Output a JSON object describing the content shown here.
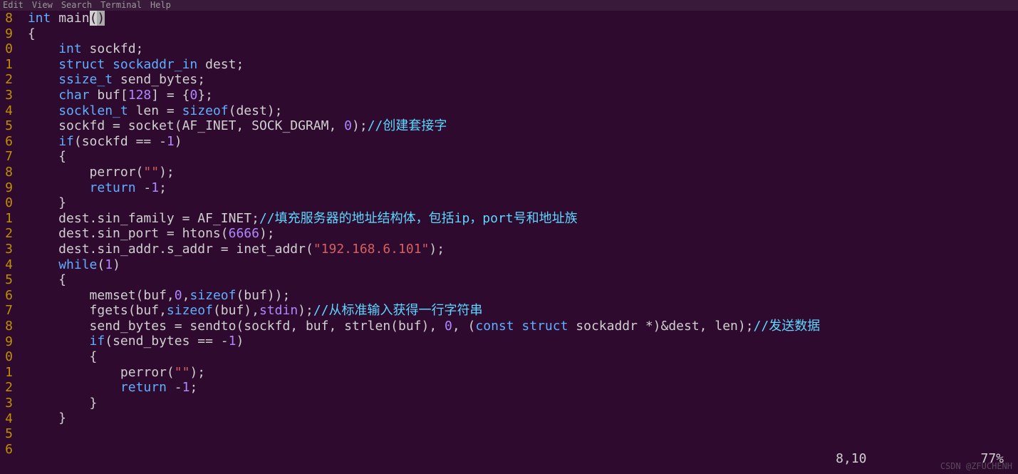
{
  "menubar": [
    "Edit",
    "View",
    "Search",
    "Terminal",
    "Help"
  ],
  "lines": [
    {
      "n": "8",
      "tokens": [
        {
          "t": " ",
          "c": ""
        },
        {
          "t": "int",
          "c": "type"
        },
        {
          "t": " ",
          "c": ""
        },
        {
          "t": "main",
          "c": "id"
        },
        {
          "t": "(",
          "c": "paren-hl"
        },
        {
          "t": ")",
          "c": "cursor"
        }
      ]
    },
    {
      "n": "9",
      "tokens": [
        {
          "t": " {",
          "c": ""
        }
      ]
    },
    {
      "n": "0",
      "tokens": [
        {
          "t": "     ",
          "c": ""
        },
        {
          "t": "int",
          "c": "type"
        },
        {
          "t": " sockfd;",
          "c": ""
        }
      ]
    },
    {
      "n": "1",
      "tokens": [
        {
          "t": "     ",
          "c": ""
        },
        {
          "t": "struct",
          "c": "kw"
        },
        {
          "t": " ",
          "c": ""
        },
        {
          "t": "sockaddr_in",
          "c": "type"
        },
        {
          "t": " dest;",
          "c": ""
        }
      ]
    },
    {
      "n": "2",
      "tokens": [
        {
          "t": "     ",
          "c": ""
        },
        {
          "t": "ssize_t",
          "c": "type"
        },
        {
          "t": " send_bytes;",
          "c": ""
        }
      ]
    },
    {
      "n": "3",
      "tokens": [
        {
          "t": "     ",
          "c": ""
        },
        {
          "t": "char",
          "c": "type"
        },
        {
          "t": " buf[",
          "c": ""
        },
        {
          "t": "128",
          "c": "num"
        },
        {
          "t": "] = {",
          "c": ""
        },
        {
          "t": "0",
          "c": "num"
        },
        {
          "t": "};",
          "c": ""
        }
      ]
    },
    {
      "n": "4",
      "tokens": [
        {
          "t": "     ",
          "c": ""
        },
        {
          "t": "socklen_t",
          "c": "type"
        },
        {
          "t": " len = ",
          "c": ""
        },
        {
          "t": "sizeof",
          "c": "kw"
        },
        {
          "t": "(dest);",
          "c": ""
        }
      ]
    },
    {
      "n": "5",
      "tokens": [
        {
          "t": "     sockfd = socket(AF_INET, SOCK_DGRAM, ",
          "c": ""
        },
        {
          "t": "0",
          "c": "num"
        },
        {
          "t": ");",
          "c": ""
        },
        {
          "t": "//创建套接字",
          "c": "cmt"
        }
      ]
    },
    {
      "n": "6",
      "tokens": [
        {
          "t": "     ",
          "c": ""
        },
        {
          "t": "if",
          "c": "kw"
        },
        {
          "t": "(sockfd == -",
          "c": ""
        },
        {
          "t": "1",
          "c": "num"
        },
        {
          "t": ")",
          "c": ""
        }
      ]
    },
    {
      "n": "7",
      "tokens": [
        {
          "t": "     {",
          "c": ""
        }
      ]
    },
    {
      "n": "8",
      "tokens": [
        {
          "t": "         perror(",
          "c": ""
        },
        {
          "t": "\"\"",
          "c": "str"
        },
        {
          "t": ");",
          "c": ""
        }
      ]
    },
    {
      "n": "9",
      "tokens": [
        {
          "t": "         ",
          "c": ""
        },
        {
          "t": "return",
          "c": "kw"
        },
        {
          "t": " -",
          "c": ""
        },
        {
          "t": "1",
          "c": "num"
        },
        {
          "t": ";",
          "c": ""
        }
      ]
    },
    {
      "n": "0",
      "tokens": [
        {
          "t": "     }",
          "c": ""
        }
      ]
    },
    {
      "n": "1",
      "tokens": [
        {
          "t": "     dest.sin_family = AF_INET;",
          "c": ""
        },
        {
          "t": "//填充服务器的地址结构体，包括ip，port号和地址族",
          "c": "cmt"
        }
      ]
    },
    {
      "n": "2",
      "tokens": [
        {
          "t": "     dest.sin_port = htons(",
          "c": ""
        },
        {
          "t": "6666",
          "c": "num"
        },
        {
          "t": ");",
          "c": ""
        }
      ]
    },
    {
      "n": "3",
      "tokens": [
        {
          "t": "     dest.sin_addr.s_addr = inet_addr(",
          "c": ""
        },
        {
          "t": "\"192.168.6.101\"",
          "c": "str"
        },
        {
          "t": ");",
          "c": ""
        }
      ]
    },
    {
      "n": "4",
      "tokens": [
        {
          "t": "     ",
          "c": ""
        },
        {
          "t": "while",
          "c": "kw"
        },
        {
          "t": "(",
          "c": ""
        },
        {
          "t": "1",
          "c": "num"
        },
        {
          "t": ")",
          "c": ""
        }
      ]
    },
    {
      "n": "5",
      "tokens": [
        {
          "t": "     {",
          "c": ""
        }
      ]
    },
    {
      "n": "6",
      "tokens": [
        {
          "t": "         memset(buf,",
          "c": ""
        },
        {
          "t": "0",
          "c": "num"
        },
        {
          "t": ",",
          "c": ""
        },
        {
          "t": "sizeof",
          "c": "kw"
        },
        {
          "t": "(buf));",
          "c": ""
        }
      ]
    },
    {
      "n": "7",
      "tokens": [
        {
          "t": "         fgets(buf,",
          "c": ""
        },
        {
          "t": "sizeof",
          "c": "kw"
        },
        {
          "t": "(buf),",
          "c": ""
        },
        {
          "t": "stdin",
          "c": "num"
        },
        {
          "t": ");",
          "c": ""
        },
        {
          "t": "//从标准输入获得一行字符串",
          "c": "cmt"
        }
      ]
    },
    {
      "n": "8",
      "tokens": [
        {
          "t": "         send_bytes = sendto(sockfd, buf, strlen(buf), ",
          "c": ""
        },
        {
          "t": "0",
          "c": "num"
        },
        {
          "t": ", (",
          "c": ""
        },
        {
          "t": "const",
          "c": "kw"
        },
        {
          "t": " ",
          "c": ""
        },
        {
          "t": "struct",
          "c": "kw"
        },
        {
          "t": " sockaddr *)&dest, len);",
          "c": ""
        },
        {
          "t": "//发送数据",
          "c": "cmt"
        }
      ]
    },
    {
      "n": "9",
      "tokens": [
        {
          "t": "         ",
          "c": ""
        },
        {
          "t": "if",
          "c": "kw"
        },
        {
          "t": "(send_bytes == -",
          "c": ""
        },
        {
          "t": "1",
          "c": "num"
        },
        {
          "t": ")",
          "c": ""
        }
      ]
    },
    {
      "n": "0",
      "tokens": [
        {
          "t": "         {",
          "c": ""
        }
      ]
    },
    {
      "n": "1",
      "tokens": [
        {
          "t": "             perror(",
          "c": ""
        },
        {
          "t": "\"\"",
          "c": "str"
        },
        {
          "t": ");",
          "c": ""
        }
      ]
    },
    {
      "n": "2",
      "tokens": [
        {
          "t": "             ",
          "c": ""
        },
        {
          "t": "return",
          "c": "kw"
        },
        {
          "t": " -",
          "c": ""
        },
        {
          "t": "1",
          "c": "num"
        },
        {
          "t": ";",
          "c": ""
        }
      ]
    },
    {
      "n": "3",
      "tokens": [
        {
          "t": "         }",
          "c": ""
        }
      ]
    },
    {
      "n": "4",
      "tokens": [
        {
          "t": "",
          "c": ""
        }
      ]
    },
    {
      "n": "5",
      "tokens": [
        {
          "t": "     }",
          "c": ""
        }
      ]
    },
    {
      "n": "6",
      "tokens": [
        {
          "t": "",
          "c": ""
        }
      ]
    }
  ],
  "status": {
    "pos": "8,10",
    "pct": "77%"
  },
  "watermark": "CSDN @ZFUCHENH"
}
